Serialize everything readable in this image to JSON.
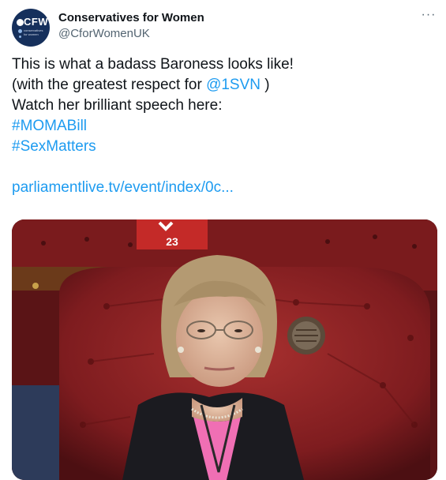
{
  "account": {
    "display_name": "Conservatives for Women",
    "handle": "@CforWomenUK",
    "avatar_text": "CFW",
    "avatar_subtext": "conservatives for women"
  },
  "more_label": "···",
  "tweet": {
    "line1": "This is what a badass Baroness looks like!",
    "line2_before": "(with the greatest respect for ",
    "mention": "@1SVN",
    "line2_after": " )",
    "line3": "Watch her brilliant speech here:",
    "hashtag1": "#MOMABill",
    "hashtag2": "#SexMatters",
    "url": "parliamentlive.tv/event/index/0c..."
  },
  "media": {
    "seat_number": "23"
  },
  "colors": {
    "link": "#1d9bf0",
    "text": "#0f1419",
    "secondary": "#536471",
    "avatar_bg": "#16305c",
    "leather": "#8a1f22"
  },
  "icons": {
    "more": "more-dots-icon"
  }
}
